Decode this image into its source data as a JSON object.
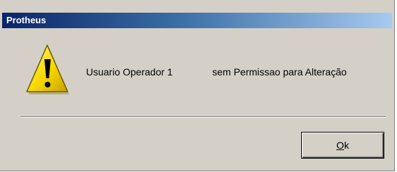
{
  "window": {
    "title": "Protheus"
  },
  "dialog": {
    "icon": "warning-icon",
    "message_user": "Usuario Operador 1",
    "message_permission": "sem Permissao para Alteração"
  },
  "buttons": {
    "ok_mnemonic": "O",
    "ok_rest": "k"
  },
  "colors": {
    "titlebar_start": "#0a246a",
    "titlebar_end": "#a6caf0",
    "dialog_background": "#d4d0c8",
    "warning_yellow": "#f8d800"
  }
}
